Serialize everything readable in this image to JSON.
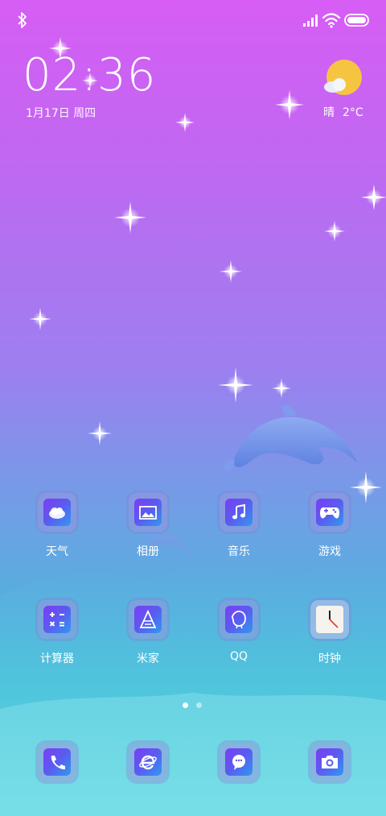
{
  "status_bar": {
    "bluetooth_icon": "bluetooth-icon",
    "signal_icon": "signal-icon",
    "wifi_icon": "wifi-icon",
    "battery_icon": "battery-icon"
  },
  "clock": {
    "time": "02:36",
    "date": "1月17日 周四"
  },
  "weather": {
    "condition": "晴",
    "temperature": "2°C",
    "icon": "sun-cloud-icon"
  },
  "apps": [
    {
      "label": "天气",
      "icon": "weather-app-icon"
    },
    {
      "label": "相册",
      "icon": "gallery-app-icon"
    },
    {
      "label": "音乐",
      "icon": "music-app-icon"
    },
    {
      "label": "游戏",
      "icon": "game-app-icon"
    },
    {
      "label": "计算器",
      "icon": "calculator-app-icon"
    },
    {
      "label": "米家",
      "icon": "mijia-app-icon"
    },
    {
      "label": "QQ",
      "icon": "qq-app-icon"
    },
    {
      "label": "时钟",
      "icon": "clock-app-icon"
    }
  ],
  "dock": [
    {
      "icon": "phone-app-icon"
    },
    {
      "icon": "browser-app-icon"
    },
    {
      "icon": "messages-app-icon"
    },
    {
      "icon": "camera-app-icon"
    }
  ],
  "pager": {
    "pages": 2,
    "current": 1
  },
  "colors": {
    "bg_top": "#d75df5",
    "bg_bottom": "#2ec6cf",
    "icon_gradient_start": "#7b3cf5",
    "icon_gradient_end": "#2e9af0",
    "sun": "#f5c542"
  }
}
